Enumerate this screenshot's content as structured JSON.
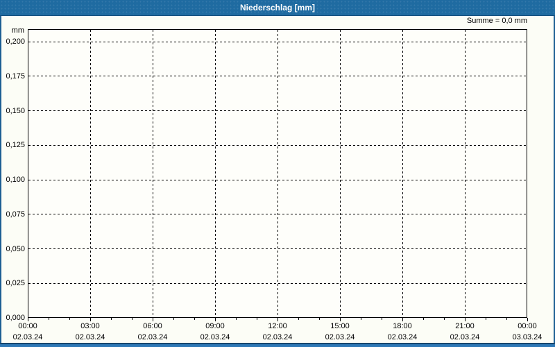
{
  "window": {
    "title": "Niederschlag [mm]"
  },
  "summary": "Summe = 0,0 mm",
  "axes": {
    "unit": "mm",
    "y_ticks": [
      "0,200",
      "0,175",
      "0,150",
      "0,125",
      "0,100",
      "0,075",
      "0,050",
      "0,025",
      "0,000"
    ],
    "x_ticks": [
      {
        "time": "00:00",
        "date": "02.03.24"
      },
      {
        "time": "03:00",
        "date": "02.03.24"
      },
      {
        "time": "06:00",
        "date": "02.03.24"
      },
      {
        "time": "09:00",
        "date": "02.03.24"
      },
      {
        "time": "12:00",
        "date": "02.03.24"
      },
      {
        "time": "15:00",
        "date": "02.03.24"
      },
      {
        "time": "18:00",
        "date": "02.03.24"
      },
      {
        "time": "21:00",
        "date": "02.03.24"
      },
      {
        "time": "00:00",
        "date": "03.03.24"
      }
    ],
    "minor_ticks_per_interval": 3
  },
  "colors": {
    "titlebar": "#1f6ba1",
    "window_border": "#1d5f94",
    "bottom_strip": "#2e78b6",
    "bottom_strip_line": "#16456d",
    "background": "#fcfdf6",
    "grid": "#000000",
    "text": "#000000",
    "title_text": "#ffffff"
  },
  "chart_data": {
    "type": "bar",
    "title": "Niederschlag [mm]",
    "xlabel": "",
    "ylabel": "mm",
    "x": [
      "02.03.24 00:00",
      "02.03.24 03:00",
      "02.03.24 06:00",
      "02.03.24 09:00",
      "02.03.24 12:00",
      "02.03.24 15:00",
      "02.03.24 18:00",
      "02.03.24 21:00",
      "03.03.24 00:00"
    ],
    "series": [
      {
        "name": "Niederschlag [mm]",
        "values": [
          0,
          0,
          0,
          0,
          0,
          0,
          0,
          0,
          0
        ]
      }
    ],
    "ylim": [
      0,
      0.21
    ],
    "y_tick_step": 0.025,
    "grid": "dashed",
    "legend": "none",
    "annotations": [
      "Summe = 0,0 mm"
    ]
  }
}
